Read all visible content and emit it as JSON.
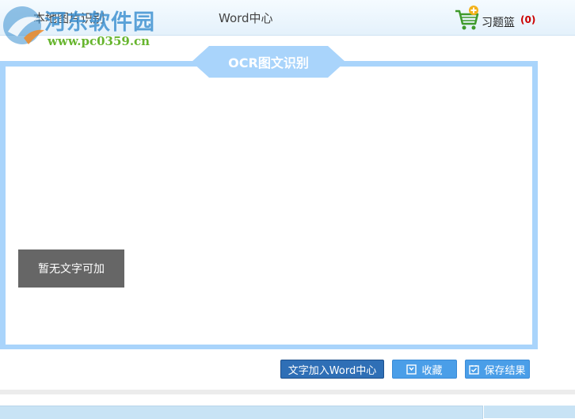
{
  "nav": {
    "tabs": [
      {
        "label": "本地图片识别"
      },
      {
        "label": "Word中心"
      }
    ]
  },
  "watermark": {
    "title": "河东软件园",
    "url": "www.pc0359.cn"
  },
  "basket": {
    "label": "习题篮",
    "count": "(0)",
    "icon": "cart-plus-icon"
  },
  "ocr": {
    "title": "OCR图文识别",
    "empty_button": "暂无文字可加"
  },
  "actions": {
    "add_to_word": "文字加入Word中心",
    "favorite": "收藏",
    "save": "保存结果"
  },
  "colors": {
    "frame": "#a9d4fb",
    "primary_button": "#2f6fb6",
    "secondary_button": "#4a9ee8",
    "disabled_button": "#666666",
    "count": "#cc0000"
  }
}
